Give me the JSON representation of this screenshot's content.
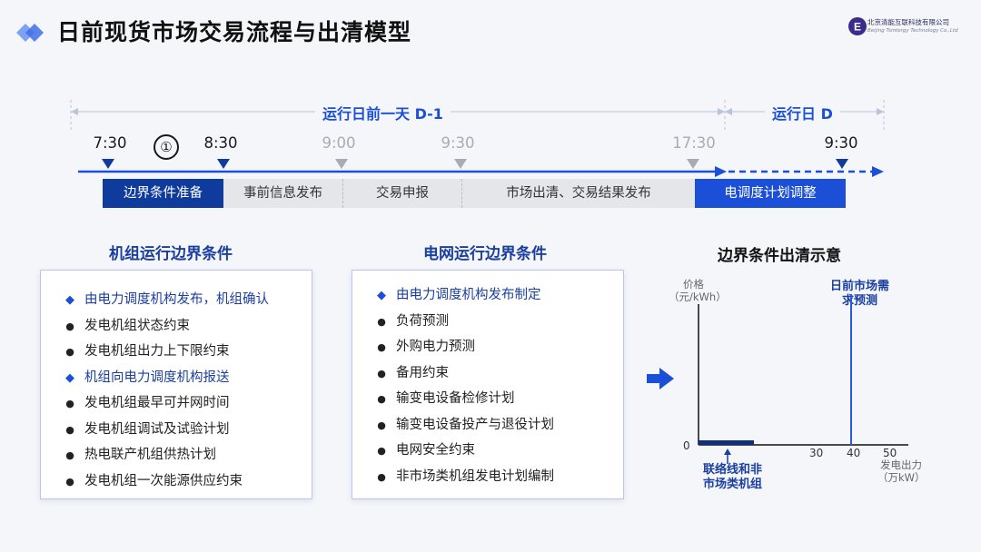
{
  "header": {
    "title": "日前现货市场交易流程与出清模型",
    "company_name": "北京清能互联科技有限公司",
    "company_name_en": "Beijing Tsintergy Technology Co.,Ltd"
  },
  "timeline": {
    "span_before": "运行日前一天 D-1",
    "span_day": "运行日 D",
    "step_marker": "①",
    "times": [
      {
        "label": "7:30",
        "state": "active"
      },
      {
        "label": "8:30",
        "state": "active"
      },
      {
        "label": "9:00",
        "state": "muted"
      },
      {
        "label": "9:30",
        "state": "muted"
      },
      {
        "label": "17:30",
        "state": "muted"
      },
      {
        "label": "9:30",
        "state": "active"
      }
    ],
    "phases": [
      "边界条件准备",
      "事前信息发布",
      "交易申报",
      "市场出清、交易结果发布",
      "电调度计划调整"
    ]
  },
  "unit_panel": {
    "title": "机组运行边界条件",
    "items": [
      {
        "type": "head",
        "text": "由电力调度机构发布，机组确认"
      },
      {
        "type": "dot",
        "text": "发电机组状态约束"
      },
      {
        "type": "dot",
        "text": "发电机组出力上下限约束"
      },
      {
        "type": "head",
        "text": "机组向电力调度机构报送"
      },
      {
        "type": "dot",
        "text": "发电机组最早可并网时间"
      },
      {
        "type": "dot",
        "text": "发电机组调试及试验计划"
      },
      {
        "type": "dot",
        "text": "热电联产机组供热计划"
      },
      {
        "type": "dot",
        "text": "发电机组一次能源供应约束"
      }
    ]
  },
  "grid_panel": {
    "title": "电网运行边界条件",
    "items": [
      {
        "type": "head",
        "text": "由电力调度机构发布制定"
      },
      {
        "type": "dot",
        "text": "负荷预测"
      },
      {
        "type": "dot",
        "text": "外购电力预测"
      },
      {
        "type": "dot",
        "text": "备用约束"
      },
      {
        "type": "dot",
        "text": "输变电设备检修计划"
      },
      {
        "type": "dot",
        "text": "输变电设备投产与退役计划"
      },
      {
        "type": "dot",
        "text": "电网安全约束"
      },
      {
        "type": "dot",
        "text": "非市场类机组发电计划编制"
      }
    ]
  },
  "chart": {
    "title": "边界条件出清示意",
    "ylabel_line1": "价格",
    "ylabel_line2": "（元/kWh）",
    "xlabel_line1": "发电出力",
    "xlabel_line2": "（万kW）",
    "origin_label": "0",
    "demand_label_line1": "日前市场需",
    "demand_label_line2": "求预测",
    "fixed_label_line1": "联络线和非",
    "fixed_label_line2": "市场类机组",
    "x_ticks": [
      "30",
      "40",
      "50"
    ]
  },
  "chart_data": {
    "type": "line",
    "title": "边界条件出清示意",
    "xlabel": "发电出力（万kW）",
    "ylabel": "价格（元/kWh）",
    "x_ticks": [
      0,
      30,
      40,
      50
    ],
    "demand_forecast_x": 42,
    "fixed_block": {
      "x_start": 0,
      "x_end": 15,
      "y": 0
    }
  },
  "colors": {
    "accent": "#1b4fd8",
    "dark_accent": "#0f3b9c",
    "muted": "#a8acb3"
  }
}
